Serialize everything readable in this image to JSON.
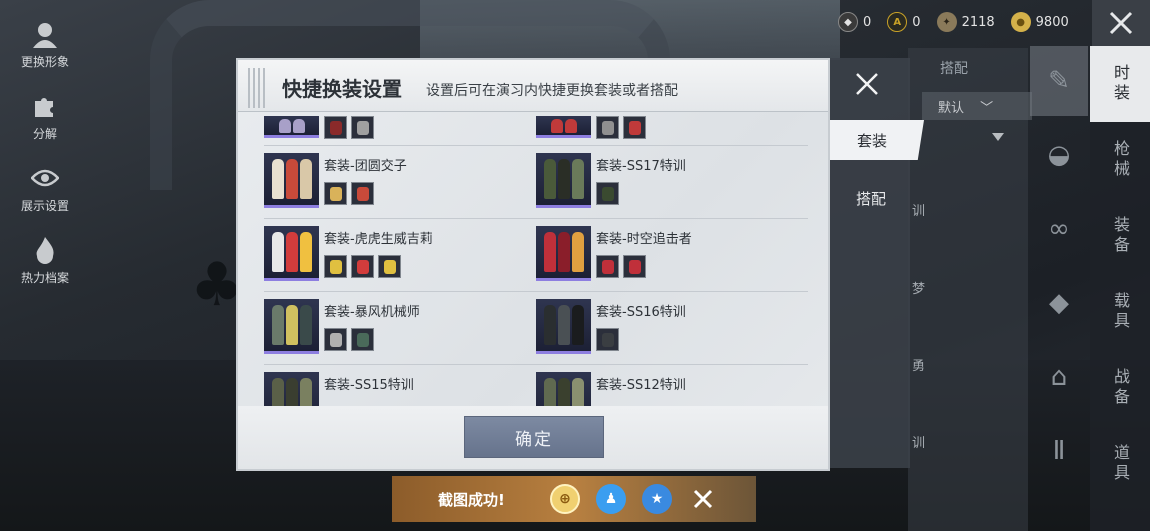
{
  "left_menu": [
    {
      "label": "更换形象",
      "icon": "avatar-icon"
    },
    {
      "label": "分解",
      "icon": "puzzle-icon"
    },
    {
      "label": "展示设置",
      "icon": "eye-icon"
    },
    {
      "label": "热力档案",
      "icon": "flame-icon"
    }
  ],
  "currency": [
    {
      "icon": "dark-coin-icon",
      "value": "0",
      "color": "#3a3a3a"
    },
    {
      "icon": "a-coin-icon",
      "value": "0",
      "color": "#c9a227"
    },
    {
      "icon": "badge-icon",
      "value": "2118",
      "color": "#8a7a5a"
    },
    {
      "icon": "gold-coin-icon",
      "value": "9800",
      "color": "#d4b14a"
    }
  ],
  "background_panel": {
    "tab": "搭配",
    "dropdown": "默认",
    "texts": [
      "训",
      "梦",
      "勇",
      "训"
    ]
  },
  "categories": [
    "时装",
    "枪械",
    "装备",
    "载具",
    "战备",
    "道具"
  ],
  "modal": {
    "title": "快捷换装设置",
    "subtitle": "设置后可在演习内快捷更换套装或者搭配",
    "confirm": "确定",
    "tabs": {
      "suit": "套装",
      "combo": "搭配"
    },
    "items": [
      {
        "name": "套装-团圆交子",
        "colors": [
          "#e8e0d0",
          "#c84a3a",
          "#d9c8a8"
        ],
        "parts": [
          "#d9b25a",
          "#c84a3a"
        ]
      },
      {
        "name": "套装-SS17特训",
        "colors": [
          "#4a5a3a",
          "#2a2e26",
          "#6a7a5a"
        ],
        "parts": [
          "#3a4a30"
        ]
      },
      {
        "name": "套装-虎虎生威吉莉",
        "colors": [
          "#e8e8e8",
          "#d23c3c",
          "#f0c040"
        ],
        "parts": [
          "#e0c040",
          "#d23c3c",
          "#e0c040"
        ]
      },
      {
        "name": "套装-时空追击者",
        "colors": [
          "#c0303a",
          "#8a1e2a",
          "#e0a040"
        ],
        "parts": [
          "#c0303a",
          "#c0303a"
        ]
      },
      {
        "name": "套装-暴风机械师",
        "colors": [
          "#6a7a6a",
          "#d0c060",
          "#3a4a4a"
        ],
        "parts": [
          "#b0b0b0",
          "#4a6a5a"
        ]
      },
      {
        "name": "套装-SS16特训",
        "colors": [
          "#2a2e30",
          "#4a5054",
          "#1a1c1e"
        ],
        "parts": [
          "#3a3e42"
        ]
      },
      {
        "name": "套装-SS15特训",
        "colors": [
          "#5a6048",
          "#3a3e30",
          "#7a8060"
        ],
        "parts": []
      },
      {
        "name": "套装-SS12特训",
        "colors": [
          "#606a50",
          "#3a402e",
          "#8a9070"
        ],
        "parts": []
      }
    ]
  },
  "toast": {
    "text": "截图成功!",
    "share_icons": [
      "gold-share-icon",
      "qq-icon",
      "qzone-icon"
    ]
  }
}
